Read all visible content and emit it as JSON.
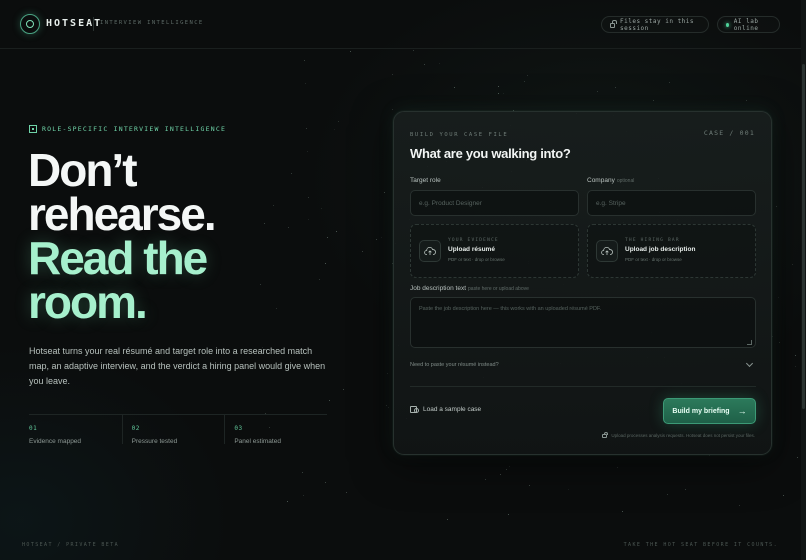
{
  "header": {
    "brand": "HOTSEAT",
    "tagline": "INTERVIEW INTELLIGENCE",
    "session_pill": "Files stay in this session",
    "ai_pill": "AI lab online"
  },
  "hero": {
    "eyebrow": "ROLE-SPECIFIC INTERVIEW INTELLIGENCE",
    "headline_line1": "Don’t",
    "headline_line2": "rehearse.",
    "headline_line3": "Read the",
    "headline_line4": "room.",
    "lede": "Hotseat turns your real résumé and target role into a researched match map, an adaptive interview, and the verdict a hiring panel would give when you leave.",
    "stats": [
      {
        "num": "01",
        "label": "Evidence mapped"
      },
      {
        "num": "02",
        "label": "Pressure tested"
      },
      {
        "num": "03",
        "label": "Panel estimated"
      }
    ]
  },
  "card": {
    "kicker": "BUILD YOUR CASE FILE",
    "case_no": "CASE / 001",
    "title": "What are you walking into?",
    "target_role": {
      "label": "Target role",
      "placeholder": "e.g. Product Designer"
    },
    "company": {
      "label": "Company",
      "optional": "optional",
      "placeholder": "e.g. Stripe"
    },
    "upload_resume": {
      "kicker": "YOUR EVIDENCE",
      "title": "Upload résumé",
      "hint": "PDF or text · drop or browse"
    },
    "upload_jd": {
      "kicker": "THE HIRING BAR",
      "title": "Upload job description",
      "hint": "PDF or text · drop or browse"
    },
    "jd_text": {
      "label": "Job description text",
      "sub": "paste here or upload above",
      "placeholder": "Paste the job description here — this works with an uploaded résumé PDF."
    },
    "paste_toggle": "Need to paste your résumé instead?",
    "sample": "Load a sample case",
    "cta": "Build my briefing",
    "cta_arrow": "→",
    "privacy": "Upload processes analysis requests. Hotseat does not persist your files."
  },
  "footer": {
    "left": "HOTSEAT / PRIVATE BETA",
    "right": "TAKE THE HOT SEAT BEFORE IT COUNTS."
  },
  "colors": {
    "accent": "#a6f0cd",
    "cta": "#2c7a5b",
    "background": "#0b0d0d"
  }
}
